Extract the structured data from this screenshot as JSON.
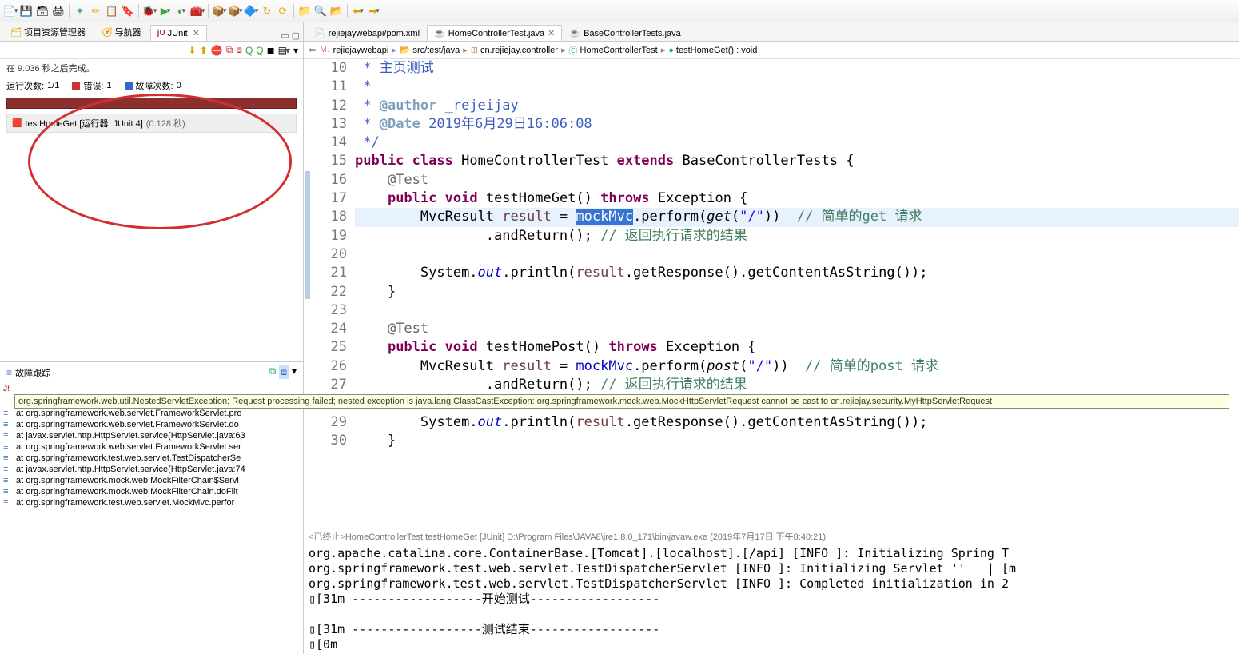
{
  "toolbar_icons": [
    "📄",
    "💾",
    "🗃",
    "🖨",
    "|",
    "🔍",
    "🖊",
    "📝",
    "🔖",
    "|",
    "🐞",
    "▶",
    "🔧",
    "☕",
    "|",
    "📦",
    "🔄",
    "↩",
    "↪",
    "|",
    "📁",
    "🔍",
    "📂",
    "|",
    "🔙",
    "🔜"
  ],
  "left": {
    "tabs": [
      {
        "icon": "📁",
        "label": "项目资源管理器"
      },
      {
        "icon": "🧭",
        "label": "导航器"
      },
      {
        "icon": "jU",
        "label": "JUnit",
        "active": true
      }
    ],
    "junit_toolbar_icons": [
      "⬇",
      "⬆",
      "⛔",
      "🔁",
      "🔃",
      "📊",
      "👁",
      "📅",
      "▤",
      "▾"
    ],
    "status": "在 9.036 秒之后完成。",
    "counters": {
      "runs_label": "运行次数:",
      "runs_value": "1/1",
      "errors_label": "错误:",
      "errors_value": "1",
      "failures_label": "故障次数:",
      "failures_value": "0"
    },
    "test_item": {
      "icon": "🟥",
      "name": "testHomeGet [运行器: JUnit 4]",
      "time": "(0.128 秒)"
    },
    "failure_trace_label": "故障跟踪",
    "stack_tooltip": "org.springframework.web.util.NestedServletException: Request processing failed; nested exception is java.lang.ClassCastException: org.springframework.mock.web.MockHttpServletRequest cannot be cast to cn.rejiejay.security.MyHttpServletRequest",
    "stack": [
      "at org.springframework.web.servlet.FrameworkServlet.pro",
      "at org.springframework.web.servlet.FrameworkServlet.do",
      "at javax.servlet.http.HttpServlet.service(HttpServlet.java:63",
      "at org.springframework.web.servlet.FrameworkServlet.ser",
      "at org.springframework.test.web.servlet.TestDispatcherSe",
      "at javax.servlet.http.HttpServlet.service(HttpServlet.java:74",
      "at org.springframework.mock.web.MockFilterChain$Servl",
      "at org.springframework.mock.web.MockFilterChain.doFilt",
      "at org.springframework.test.web.servlet.MockMvc.perfor"
    ]
  },
  "editor": {
    "tabs": [
      {
        "icon": "📄",
        "label": "rejiejaywebapi/pom.xml"
      },
      {
        "icon": "☕",
        "label": "HomeControllerTest.java",
        "active": true
      },
      {
        "icon": "☕",
        "label": "BaseControllerTests.java"
      }
    ],
    "breadcrumb": [
      {
        "icon": "📦",
        "label": "rejiejaywebapi"
      },
      {
        "icon": "📂",
        "label": "src/test/java"
      },
      {
        "icon": "📦",
        "label": "cn.rejiejay.controller"
      },
      {
        "icon": "🟢",
        "label": "HomeControllerTest"
      },
      {
        "icon": "●",
        "label": "testHomeGet() : void"
      }
    ],
    "code": {
      "l10": " * 主页测试",
      "l11": " * ",
      "l12_tag": "@author",
      "l12_val": " _rejeijay",
      "l13_tag": "@Date",
      "l13_val": " 2019年6月29日16:06:08",
      "l14": " */",
      "l15_public": "public",
      "l15_class": "class",
      "l15_name": "HomeControllerTest",
      "l15_extends": "extends",
      "l15_base": "BaseControllerTests",
      "l16": "@Test",
      "l17_public": "public",
      "l17_void": "void",
      "l17_name": "testHomeGet",
      "l17_throws": "throws",
      "l17_exc": "Exception",
      "l18_type": "MvcResult",
      "l18_var": "result",
      "l18_mock": "mockMvc",
      "l18_perform": ".perform(",
      "l18_get": "get",
      "l18_url": "\"/\"",
      "l18_cmt": "// 简单的",
      "l18_cmt2": "get",
      "l18_cmt3": " 请求",
      "l19_ret": ".andReturn();",
      "l19_cmt": "// 返回执行请求的结果",
      "l21_sys": "System.",
      "l21_out": "out",
      "l21_rest": ".println(",
      "l21_var": "result",
      "l21_rest2": ".getResponse().getContentAsString());",
      "l24": "@Test",
      "l25_public": "public",
      "l25_void": "void",
      "l25_name": "testHomePost",
      "l25_throws": "throws",
      "l25_exc": "Exception",
      "l26_type": "MvcResult",
      "l26_var": "result",
      "l26_mock": "mockMvc",
      "l26_perform": ".perform(",
      "l26_post": "post",
      "l26_url": "\"/\"",
      "l26_cmt": "// 简单的",
      "l26_cmt2": "post",
      "l26_cmt3": " 请求",
      "l27_ret": ".andReturn();",
      "l27_cmt": "// 返回执行请求的结果",
      "l29_sys": "System.",
      "l29_out": "out",
      "l29_rest": ".println(",
      "l29_var": "result",
      "l29_rest2": ".getResponse().getContentAsString());"
    }
  },
  "console": {
    "header_prefix": "<已终止>",
    "header": " HomeControllerTest.testHomeGet [JUnit] D:\\Program Files\\JAVA8\\jre1.8.0_171\\bin\\javaw.exe (2019年7月17日 下午8:40:21)",
    "lines": [
      "org.apache.catalina.core.ContainerBase.[Tomcat].[localhost].[/api] [INFO ]: Initializing Spring T",
      "org.springframework.test.web.servlet.TestDispatcherServlet [INFO ]: Initializing Servlet ''   | [m",
      "org.springframework.test.web.servlet.TestDispatcherServlet [INFO ]: Completed initialization in 2",
      "▯[31m ------------------开始测试------------------",
      "",
      "▯[31m ------------------测试结束------------------",
      "▯[0m"
    ]
  }
}
